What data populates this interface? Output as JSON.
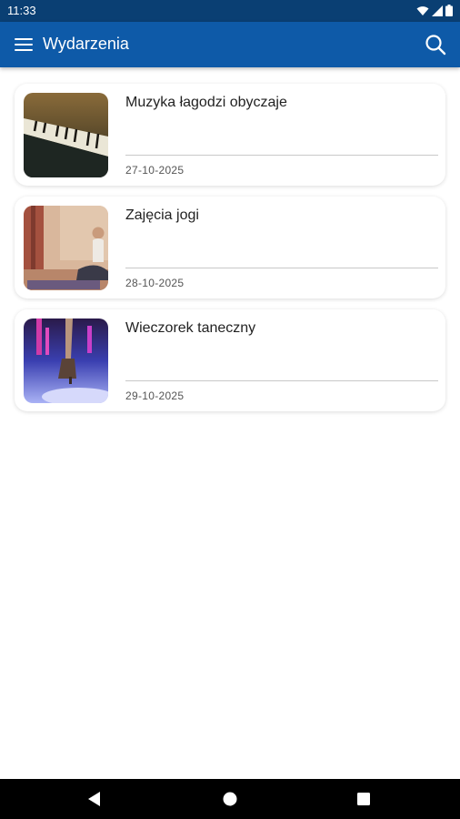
{
  "status_bar": {
    "time": "11:33"
  },
  "app_bar": {
    "title": "Wydarzenia"
  },
  "events": [
    {
      "title": "Muzyka łagodzi obyczaje",
      "date": "27-10-2025",
      "image": "piano-image"
    },
    {
      "title": "Zajęcia jogi",
      "date": "28-10-2025",
      "image": "yoga-image"
    },
    {
      "title": "Wieczorek taneczny",
      "date": "29-10-2025",
      "image": "dance-image"
    }
  ],
  "colors": {
    "status_bar": "#0a3f73",
    "app_bar": "#0e5aa8",
    "nav_bar": "#000000"
  }
}
